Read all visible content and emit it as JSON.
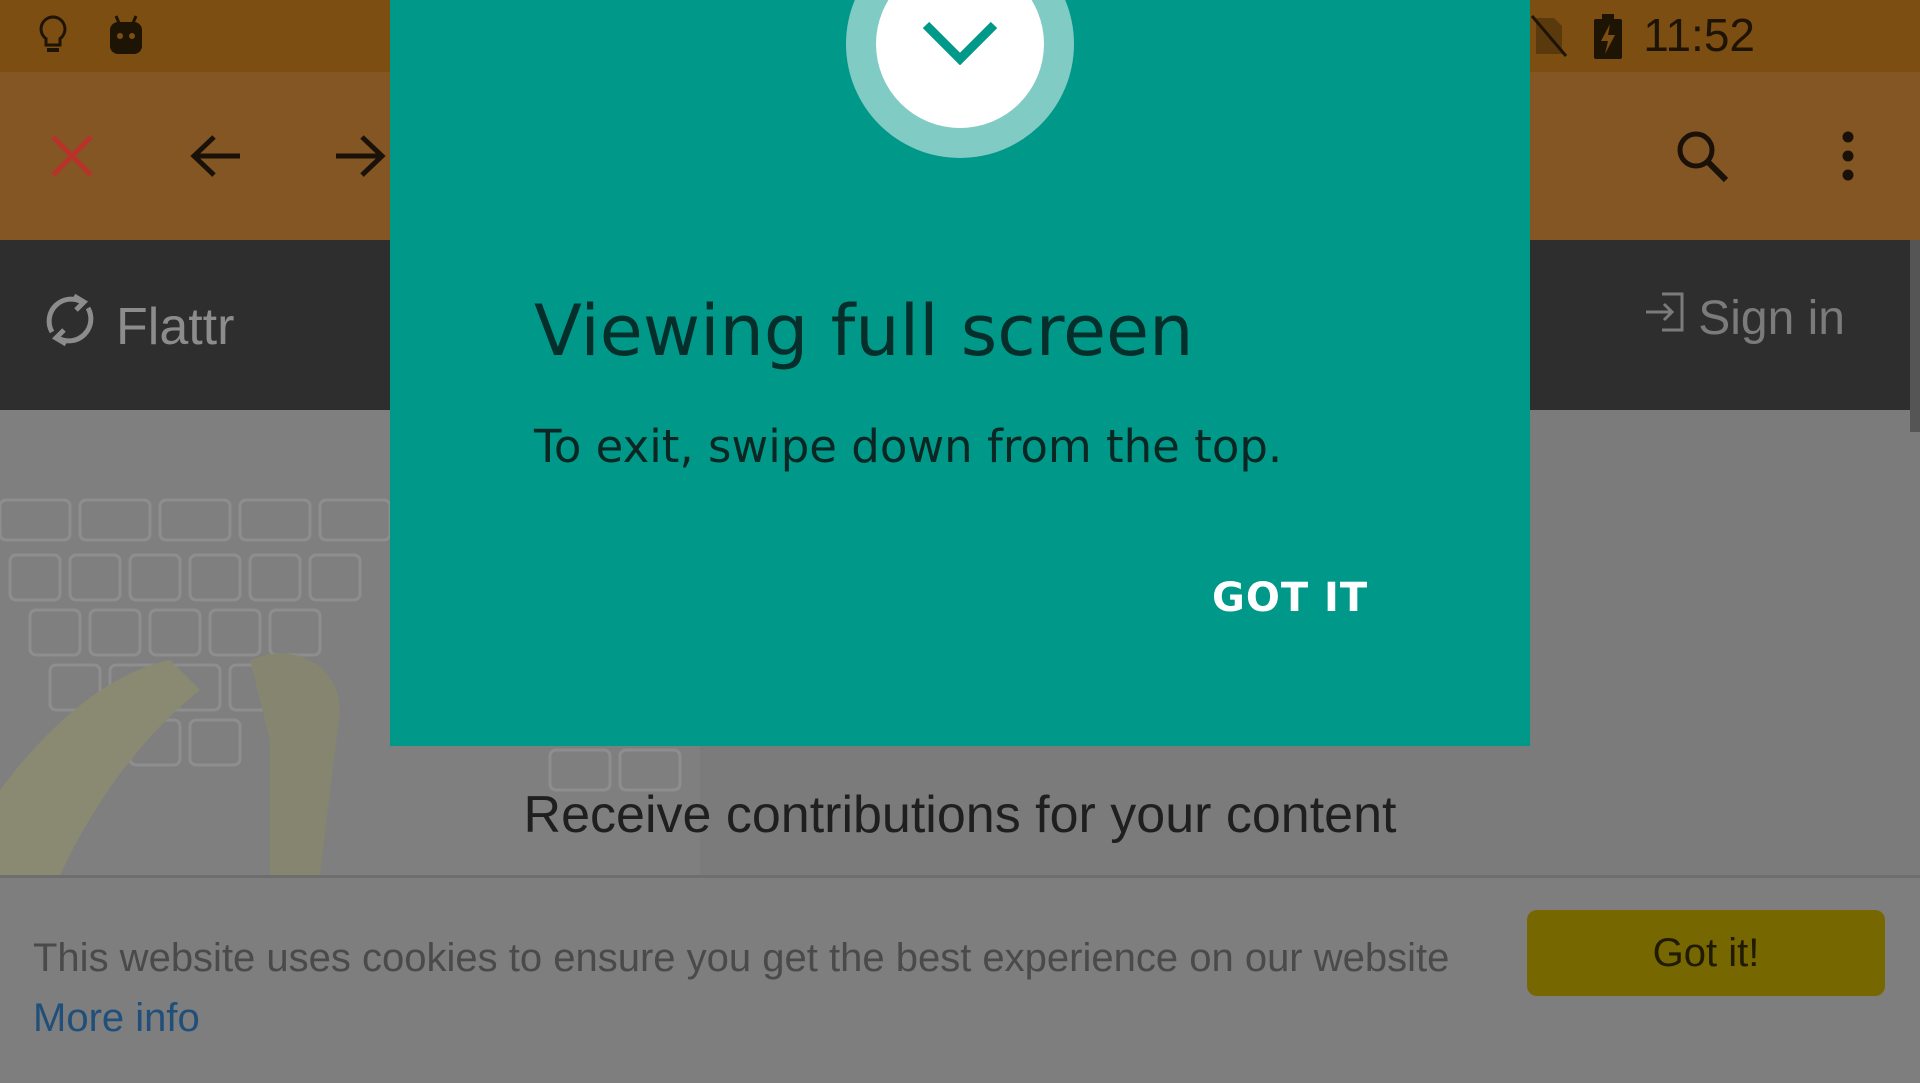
{
  "status_bar": {
    "icons": [
      "lightbulb-icon",
      "android-debug-icon",
      "no-sim-icon",
      "battery-charging-icon"
    ],
    "time": "11:52"
  },
  "toolbar": {
    "icons": [
      "close-icon",
      "back-arrow-icon",
      "forward-arrow-icon",
      "search-icon",
      "overflow-menu-icon"
    ],
    "close_color": "#c0392b"
  },
  "site": {
    "brand": "Flattr",
    "sign_in": "Sign in"
  },
  "hero": {
    "tagline": "Receive contributions for your content"
  },
  "cookie": {
    "text": "This website uses cookies to ensure you get the best experience on our website",
    "more_info": "More info",
    "button": "Got it!"
  },
  "dialog": {
    "title": "Viewing full screen",
    "body": "To exit, swipe down from the top.",
    "button": "GOT IT",
    "icon": "chevron-down-icon",
    "accent": "#009989"
  }
}
